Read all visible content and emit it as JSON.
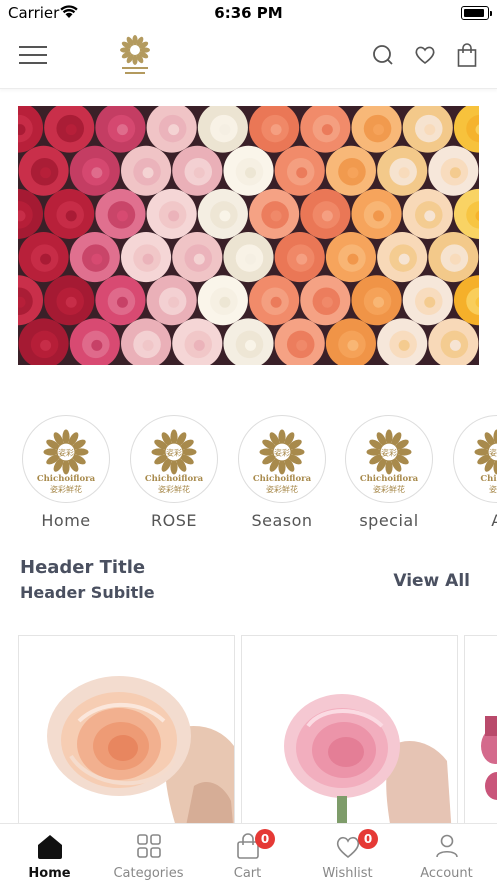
{
  "status_bar": {
    "carrier": "Carrier",
    "time": "6:36 PM"
  },
  "top_bar": {
    "menu_icon": "hamburger-menu-icon",
    "logo": "chichoiflora-logo",
    "icons": [
      "search-icon",
      "heart-icon",
      "shopping-bag-icon"
    ]
  },
  "banner": {
    "image": "roses-banner"
  },
  "categories": [
    {
      "label": "Home",
      "logo_text": "Chichoiflora",
      "logo_sub": "姿彩鲜花",
      "logo_center": "姿彩"
    },
    {
      "label": "ROSE",
      "logo_text": "Chichoiflora",
      "logo_sub": "姿彩鲜花",
      "logo_center": "姿彩"
    },
    {
      "label": "Season",
      "logo_text": "Chichoiflora",
      "logo_sub": "姿彩鲜花",
      "logo_center": "姿彩"
    },
    {
      "label": "special",
      "logo_text": "Chichoiflora",
      "logo_sub": "姿彩鲜花",
      "logo_center": "姿彩"
    },
    {
      "label": "A",
      "logo_text": "Chicho",
      "logo_sub": "姿彩",
      "logo_center": "姿彩"
    }
  ],
  "section": {
    "title": "Header Title",
    "subtitle": "Header Subitle",
    "view_all": "View All"
  },
  "bottom_nav": [
    {
      "label": "Home",
      "icon": "home-icon",
      "active": true
    },
    {
      "label": "Categories",
      "icon": "grid-icon",
      "active": false
    },
    {
      "label": "Cart",
      "icon": "cart-icon",
      "badge": "0",
      "active": false
    },
    {
      "label": "Wishlist",
      "icon": "heart-icon",
      "badge": "0",
      "active": false
    },
    {
      "label": "Account",
      "icon": "person-icon",
      "active": false
    }
  ],
  "colors": {
    "gold": "#a88a4c",
    "badge": "#e53935",
    "text_dark": "#4a5060"
  }
}
